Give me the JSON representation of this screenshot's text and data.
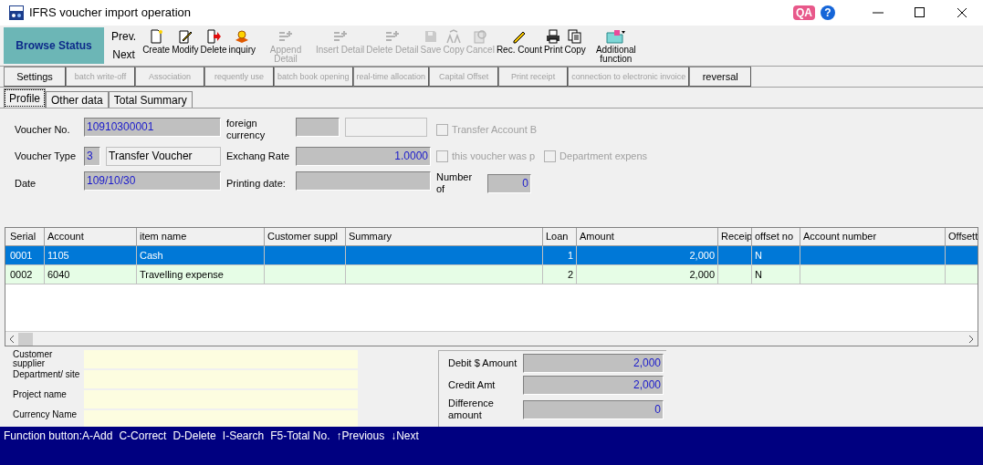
{
  "window": {
    "title": "IFRS voucher import operation",
    "qa_badge": "QA",
    "help_badge": "?"
  },
  "mode": "Browse Status",
  "nav": [
    "Prev.",
    "Next"
  ],
  "toolbar": [
    {
      "label": "Create",
      "kind": "page",
      "disabled": false
    },
    {
      "label": "Modify",
      "kind": "edit",
      "disabled": false
    },
    {
      "label": "Delete",
      "kind": "delete",
      "disabled": false
    },
    {
      "label": "inquiry",
      "kind": "search",
      "disabled": false
    },
    {
      "label": "Append Detail",
      "kind": "append",
      "disabled": true
    },
    {
      "label": "Insert Detail",
      "kind": "append",
      "disabled": true
    },
    {
      "label": "Delete Detail",
      "kind": "append",
      "disabled": true
    },
    {
      "label": "Save",
      "kind": "save",
      "disabled": true
    },
    {
      "label": "Copy",
      "kind": "letters",
      "disabled": true
    },
    {
      "label": "Cancel",
      "kind": "cancel",
      "disabled": true
    },
    {
      "label": "Rec. Count",
      "kind": "pencil",
      "disabled": false
    },
    {
      "label": "Print",
      "kind": "printer",
      "disabled": false
    },
    {
      "label": "Copy",
      "kind": "copy",
      "disabled": false
    },
    {
      "label": "Additional function",
      "kind": "folder",
      "disabled": false
    }
  ],
  "function_buttons": [
    {
      "label": "Settings",
      "disabled": false
    },
    {
      "label": "batch write-off",
      "disabled": true
    },
    {
      "label": "Association",
      "disabled": true
    },
    {
      "label": "requently use",
      "disabled": true
    },
    {
      "label": "batch book opening",
      "disabled": true
    },
    {
      "label": "real-time allocation",
      "disabled": true
    },
    {
      "label": "Capital Offset",
      "disabled": true
    },
    {
      "label": "Print receipt",
      "disabled": true
    },
    {
      "label": "connection to electronic invoice",
      "disabled": true
    },
    {
      "label": "reversal",
      "disabled": false
    }
  ],
  "tabs": [
    {
      "label": "Profile",
      "selected": true
    },
    {
      "label": "Other data",
      "selected": false
    },
    {
      "label": "Total Summary",
      "selected": false
    }
  ],
  "profile": {
    "voucher_no": {
      "label": "Voucher No.",
      "value": "10910300001"
    },
    "voucher_type": {
      "label": "Voucher Type",
      "code": "3",
      "name": "Transfer Voucher"
    },
    "date": {
      "label": "Date",
      "value": "109/10/30"
    },
    "foreign_currency": {
      "label": "foreign currency"
    },
    "exchange_rate": {
      "label": "Exchang Rate",
      "value": "1.0000"
    },
    "printing_date": {
      "label": "Printing date:"
    },
    "number_of": {
      "label": "Number of",
      "value": "0"
    },
    "checkboxes": [
      {
        "label": "Transfer Account B",
        "checked": false
      },
      {
        "label": "this voucher was p",
        "checked": false
      },
      {
        "label": "Department expens",
        "checked": false
      }
    ]
  },
  "table": {
    "columns": [
      "Serial",
      "Account",
      "item name",
      "Customer suppl",
      "Summary",
      "Loan",
      "Amount",
      "Receip",
      "offset no",
      "Account number",
      "Offsett"
    ],
    "rows": [
      {
        "selected": true,
        "cells": [
          "0001",
          "1105",
          "Cash",
          "",
          "",
          "1",
          "2,000",
          "",
          "N",
          "",
          ""
        ]
      },
      {
        "selected": false,
        "cells": [
          "0002",
          "6040",
          "Travelling expense",
          "",
          "",
          "2",
          "2,000",
          "",
          "N",
          "",
          ""
        ]
      }
    ]
  },
  "details": [
    {
      "label": "Customer supplier"
    },
    {
      "label": "Department/ site"
    },
    {
      "label": "Project name"
    },
    {
      "label": "Currency Name"
    }
  ],
  "totals": [
    {
      "label": "Debit $ Amount",
      "value": "2,000"
    },
    {
      "label": "Credit Amt",
      "value": "2,000"
    },
    {
      "label": "Difference amount",
      "value": "0"
    }
  ],
  "status_bar": {
    "segments": [
      "Function button:A-Add",
      "C-Correct",
      "D-Delete",
      "I-Search",
      "F5-Total No.",
      "↑Previous",
      "↓Next"
    ]
  }
}
